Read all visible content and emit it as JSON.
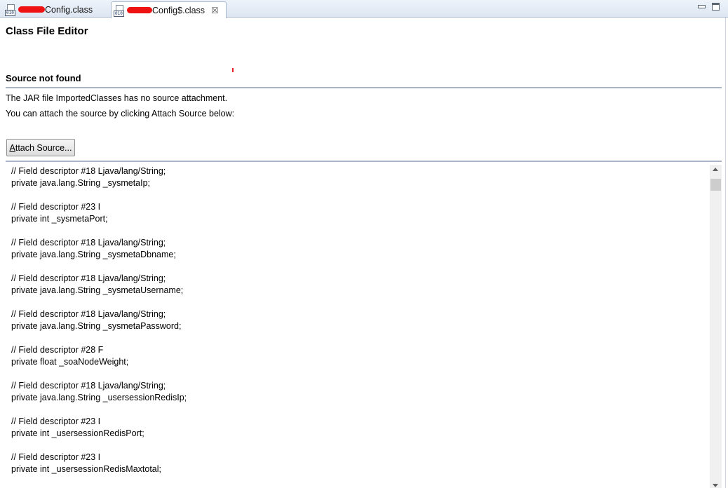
{
  "tabs": [
    {
      "label": "Config.class",
      "active": false
    },
    {
      "label": "Config$.class",
      "active": true
    }
  ],
  "editor": {
    "title": "Class File Editor",
    "section_title": "Source not found",
    "message_line1": "The JAR file ImportedClasses has no source attachment.",
    "message_line2": "You can attach the source by clicking Attach Source below:",
    "attach_button": {
      "mnemonic": "A",
      "rest": "ttach Source..."
    }
  },
  "code_lines": [
    "// Field descriptor #18 Ljava/lang/String;",
    "private java.lang.String _sysmetaIp;",
    "",
    "// Field descriptor #23 I",
    "private int _sysmetaPort;",
    "",
    "// Field descriptor #18 Ljava/lang/String;",
    "private java.lang.String _sysmetaDbname;",
    "",
    "// Field descriptor #18 Ljava/lang/String;",
    "private java.lang.String _sysmetaUsername;",
    "",
    "// Field descriptor #18 Ljava/lang/String;",
    "private java.lang.String _sysmetaPassword;",
    "",
    "// Field descriptor #28 F",
    "private float _soaNodeWeight;",
    "",
    "// Field descriptor #18 Ljava/lang/String;",
    "private java.lang.String _usersessionRedisIp;",
    "",
    "// Field descriptor #23 I",
    "private int _usersessionRedisPort;",
    "",
    "// Field descriptor #23 I",
    "private int _usersessionRedisMaxtotal;"
  ],
  "icons": {
    "tab_icon": "class-file-icon",
    "close": "close-icon",
    "minimize": "minimize-icon",
    "maximize": "maximize-icon",
    "scroll_up": "scroll-up-arrow-icon",
    "scroll_down": "scroll-down-arrow-icon"
  },
  "colors": {
    "redaction": "#ef1212",
    "separator": "#a9b4c6"
  }
}
